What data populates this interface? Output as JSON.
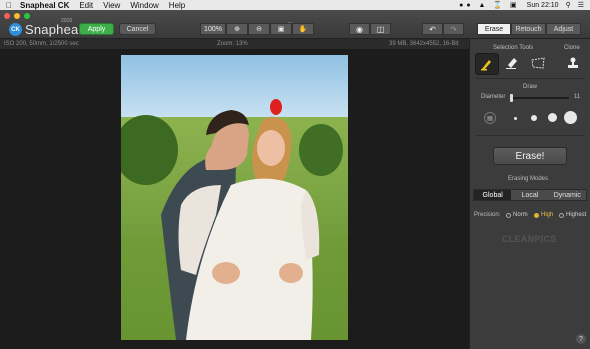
{
  "menubar": {
    "app_name": "Snapheal CK",
    "items": [
      "Edit",
      "View",
      "Window",
      "Help"
    ],
    "time": "Sun 22:10"
  },
  "toolbar": {
    "logo_badge": "CK",
    "logo_name": "Snapheal",
    "logo_version": "2016",
    "apply_label": "Apply",
    "cancel_label": "Cancel",
    "zoom_value": "100%"
  },
  "mode_tabs": {
    "erase": "Erase",
    "retouch": "Retouch",
    "adjust": "Adjust",
    "active": "Erase"
  },
  "infobar": {
    "exif": "ISO 200, 50mm, 1/2500 sec",
    "zoom": "Zoom: 13%",
    "fileinfo": "39 MB, 3642x4552, 16-Bit"
  },
  "panel": {
    "selection_tools_label": "Selection Tools",
    "clone_label": "Clone",
    "draw_label": "Draw",
    "diameter_label": "Diameter",
    "diameter_value": "11",
    "diameter_fraction": 0.03,
    "erase_button": "Erase!",
    "erasing_modes_label": "Erasing Modes",
    "modes": [
      "Global",
      "Local",
      "Dynamic"
    ],
    "active_mode": "Global",
    "precision_label": "Precision:",
    "precision_options": [
      "Norm",
      "High",
      "Highest"
    ],
    "active_precision": "High",
    "watermark": "CLEANPICS",
    "help": "?"
  },
  "colors": {
    "apply_green": "#3eae4a",
    "precision_active": "#e0b431",
    "brush_yellow": "#f0c419",
    "red_spot": "#e0201f"
  }
}
